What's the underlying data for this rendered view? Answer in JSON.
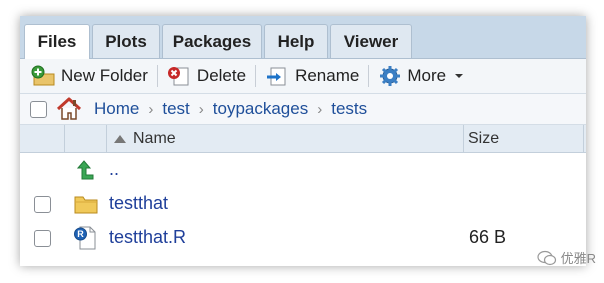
{
  "tabs": [
    {
      "label": "Files",
      "active": true
    },
    {
      "label": "Plots",
      "active": false
    },
    {
      "label": "Packages",
      "active": false
    },
    {
      "label": "Help",
      "active": false
    },
    {
      "label": "Viewer",
      "active": false
    }
  ],
  "toolbar": {
    "new_folder": "New Folder",
    "delete": "Delete",
    "rename": "Rename",
    "more": "More"
  },
  "breadcrumb": [
    "Home",
    "test",
    "toypackages",
    "tests"
  ],
  "table": {
    "columns": [
      "Name",
      "Size"
    ],
    "rows": [
      {
        "name": "..",
        "size": "",
        "type": "parent"
      },
      {
        "name": "testthat",
        "size": "",
        "type": "folder"
      },
      {
        "name": "testthat.R",
        "size": "66 B",
        "type": "r-file"
      }
    ]
  },
  "watermark": "优雅R",
  "colors": {
    "tabbar": "#c7d8e8",
    "link": "#1f3f9a",
    "header": "#e3ebf3"
  }
}
